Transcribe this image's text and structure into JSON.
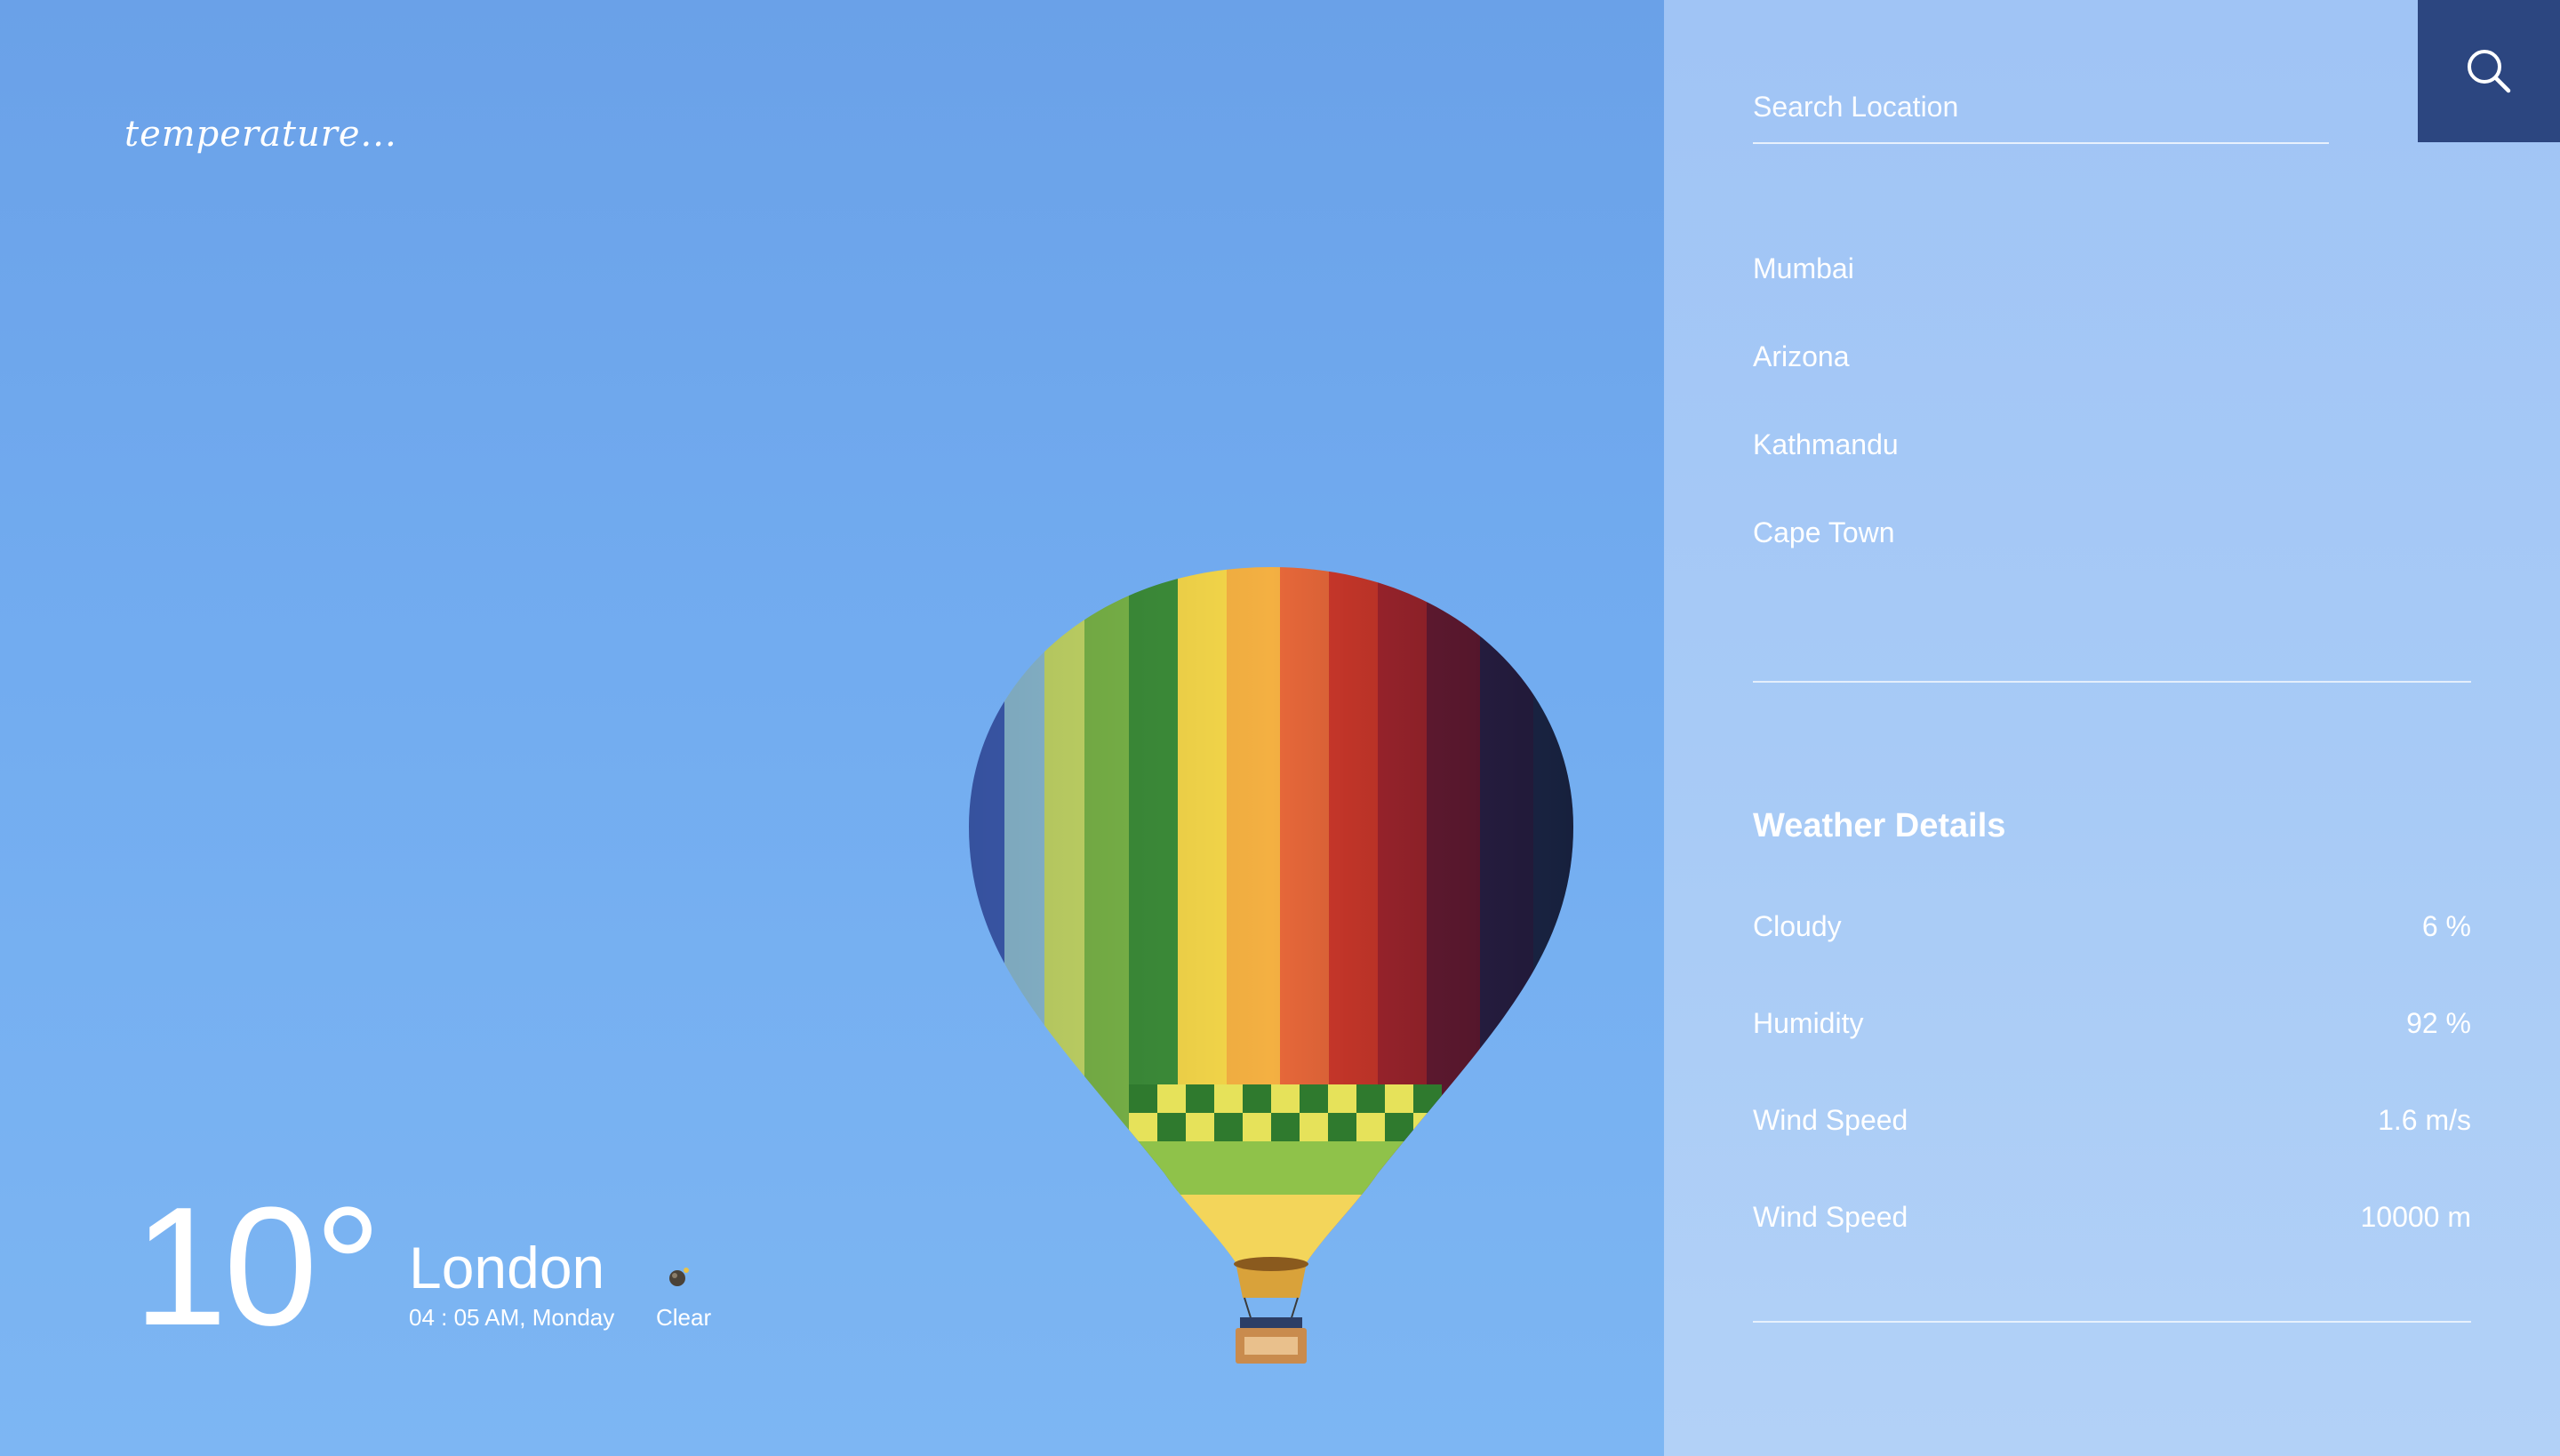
{
  "brand": {
    "logo_text": "temperature..."
  },
  "current": {
    "temperature": "10°",
    "city": "London",
    "datetime": "04 : 05 AM, Monday",
    "condition_icon": "weather-condition-icon",
    "condition": "Clear"
  },
  "search": {
    "placeholder": "Search Location",
    "value": "",
    "button_icon": "search-icon"
  },
  "locations": [
    "Mumbai",
    "Arizona",
    "Kathmandu",
    "Cape Town"
  ],
  "details": {
    "title": "Weather Details",
    "rows": [
      {
        "label": "Cloudy",
        "value": "6 %"
      },
      {
        "label": "Humidity",
        "value": "92 %"
      },
      {
        "label": "Wind Speed",
        "value": "1.6 m/s"
      },
      {
        "label": "Wind Speed",
        "value": "10000 m"
      }
    ]
  },
  "colors": {
    "sky": "#6aa1e8",
    "panel": "#a7caf6",
    "search_button": "#2c4680",
    "text": "#ffffff"
  }
}
